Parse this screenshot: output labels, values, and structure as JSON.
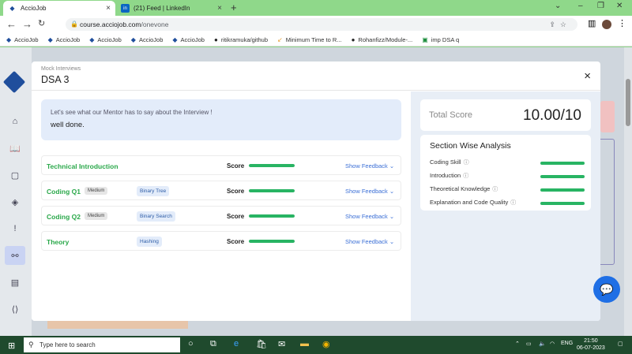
{
  "browser": {
    "tabs": [
      {
        "title": "AccioJob",
        "active": true
      },
      {
        "title": "(21) Feed | LinkedIn",
        "active": false
      }
    ],
    "url_host": "course.acciojob.com",
    "url_path": "/onevone",
    "bookmarks": [
      "AccioJob",
      "AccioJob",
      "AccioJob",
      "AccioJob",
      "AccioJob",
      "ritikramuka/github",
      "Minimum Time to R...",
      "Rohanfizz/Module-...",
      "imp DSA q"
    ]
  },
  "modal": {
    "breadcrumb": "Mock Interviews",
    "title": "DSA 3",
    "close_icon": "×",
    "mentor_prompt": "Let's see what our Mentor has to say about the Interview !",
    "mentor_feedback": "well done.",
    "rows": [
      {
        "name": "Technical Introduction",
        "difficulty": "",
        "tag": "",
        "score_label": "Score",
        "score_fraction": 1.0,
        "feedback": "Show Feedback"
      },
      {
        "name": "Coding Q1",
        "difficulty": "Medium",
        "tag": "Binary Tree",
        "score_label": "Score",
        "score_fraction": 1.0,
        "feedback": "Show Feedback"
      },
      {
        "name": "Coding Q2",
        "difficulty": "Medium",
        "tag": "Binary Search",
        "score_label": "Score",
        "score_fraction": 1.0,
        "feedback": "Show Feedback"
      },
      {
        "name": "Theory",
        "difficulty": "",
        "tag": "Hashing",
        "score_label": "Score",
        "score_fraction": 1.0,
        "feedback": "Show Feedback"
      }
    ],
    "total_score_label": "Total Score",
    "total_score": "10.00/10",
    "section_heading": "Section Wise Analysis",
    "sections": [
      {
        "label": "Coding Skill",
        "fraction": 1.0
      },
      {
        "label": "Introduction",
        "fraction": 1.0
      },
      {
        "label": "Theoretical Knowledge",
        "fraction": 1.0
      },
      {
        "label": "Explanation and Code Quality",
        "fraction": 1.0
      }
    ]
  },
  "taskbar": {
    "search_placeholder": "Type here to search",
    "language": "ENG",
    "time": "21:50",
    "date": "06-07-2023"
  },
  "colors": {
    "accent": "#2aa84a",
    "bar": "#28b463",
    "link": "#3b6fd6",
    "brand": "#1f4e9c"
  }
}
